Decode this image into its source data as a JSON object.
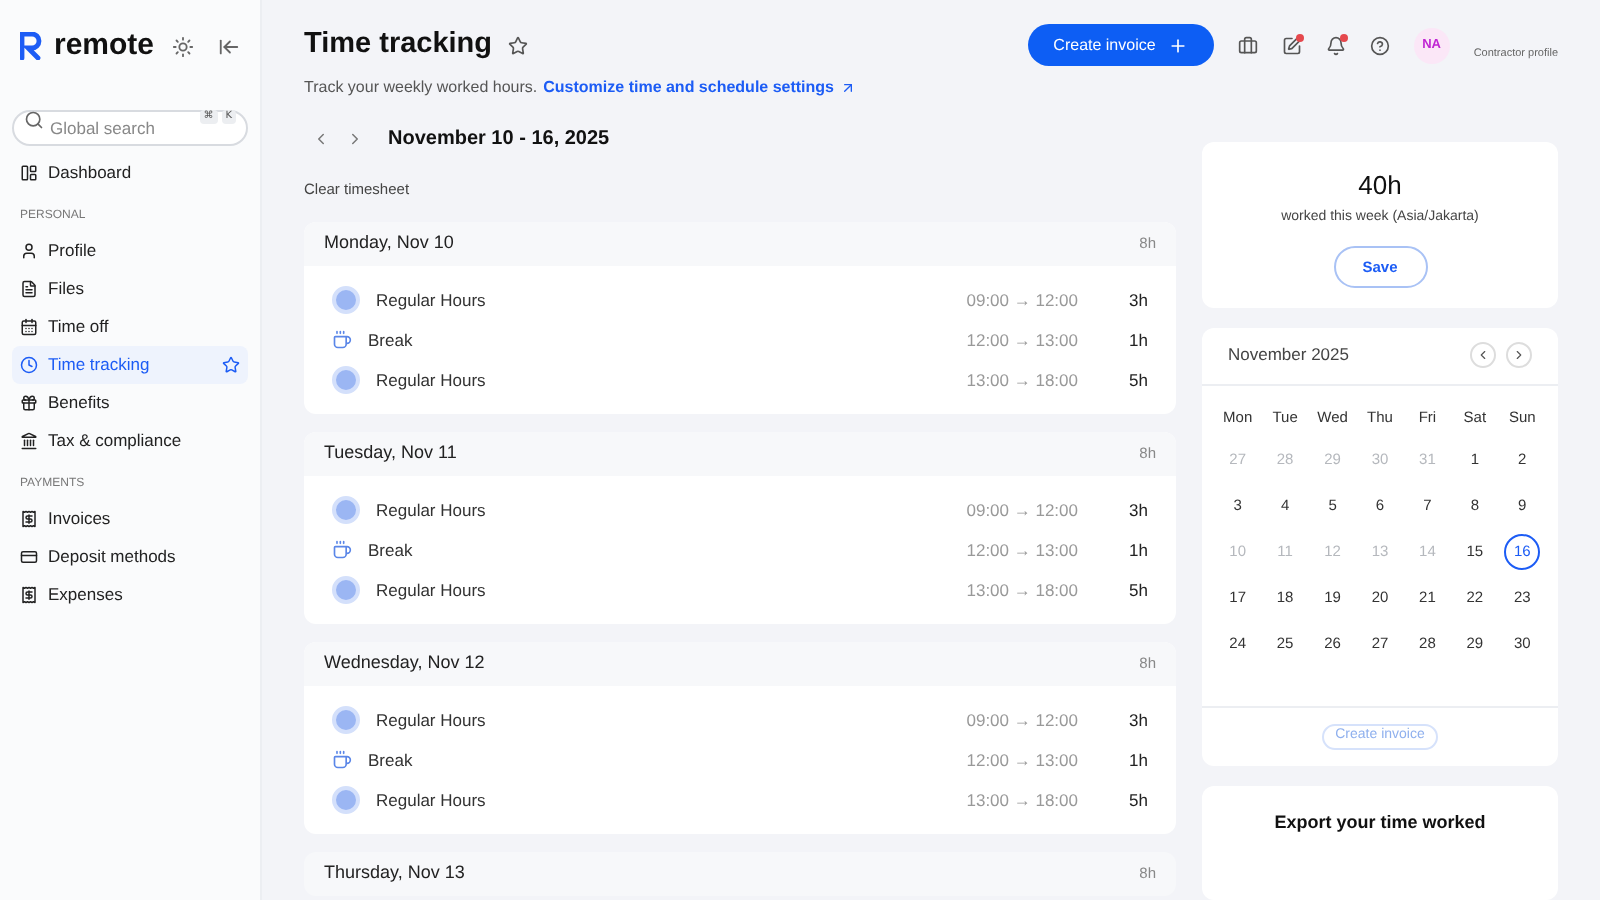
{
  "sidebar": {
    "brand": "remote",
    "search": {
      "placeholder": "Global search",
      "keys": [
        "⌘",
        "K"
      ]
    },
    "sections": [
      {
        "items": [
          {
            "label": "Dashboard",
            "selected": false
          }
        ]
      },
      {
        "title": "PERSONAL",
        "items": [
          {
            "label": "Profile",
            "selected": false
          },
          {
            "label": "Files",
            "selected": false
          },
          {
            "label": "Time off",
            "selected": false
          },
          {
            "label": "Time tracking",
            "selected": true
          },
          {
            "label": "Benefits",
            "selected": false
          },
          {
            "label": "Tax & compliance",
            "selected": false
          }
        ]
      },
      {
        "title": "PAYMENTS",
        "items": [
          {
            "label": "Invoices",
            "selected": false
          },
          {
            "label": "Deposit methods",
            "selected": false
          },
          {
            "label": "Expenses",
            "selected": false
          }
        ]
      }
    ]
  },
  "header": {
    "title": "Time tracking",
    "subtitle": "Track your weekly worked hours.",
    "link": "Customize time and schedule settings",
    "primary_button": "Create invoice",
    "toolbar": [
      {
        "notification": false
      },
      {
        "notification": true
      },
      {
        "notification": true
      },
      {
        "notification": false
      }
    ],
    "avatar": "NA",
    "profile_label": "Contractor profile"
  },
  "week": {
    "range": "November 10 - 16, 2025",
    "clear": "Clear timesheet"
  },
  "days": [
    {
      "title": "Monday, Nov 10",
      "total": "8h",
      "entries": [
        {
          "kind": "regular",
          "label": "Regular Hours",
          "time": "09:00 → 12:00",
          "hours": "3h"
        },
        {
          "kind": "break",
          "label": "Break",
          "time": "12:00 → 13:00",
          "hours": "1h"
        },
        {
          "kind": "regular",
          "label": "Regular Hours",
          "time": "13:00 → 18:00",
          "hours": "5h"
        }
      ]
    },
    {
      "title": "Tuesday, Nov 11",
      "total": "8h",
      "entries": [
        {
          "kind": "regular",
          "label": "Regular Hours",
          "time": "09:00 → 12:00",
          "hours": "3h"
        },
        {
          "kind": "break",
          "label": "Break",
          "time": "12:00 → 13:00",
          "hours": "1h"
        },
        {
          "kind": "regular",
          "label": "Regular Hours",
          "time": "13:00 → 18:00",
          "hours": "5h"
        }
      ]
    },
    {
      "title": "Wednesday, Nov 12",
      "total": "8h",
      "entries": [
        {
          "kind": "regular",
          "label": "Regular Hours",
          "time": "09:00 → 12:00",
          "hours": "3h"
        },
        {
          "kind": "break",
          "label": "Break",
          "time": "12:00 → 13:00",
          "hours": "1h"
        },
        {
          "kind": "regular",
          "label": "Regular Hours",
          "time": "13:00 → 18:00",
          "hours": "5h"
        }
      ]
    },
    {
      "title": "Thursday, Nov 13",
      "total": "8h"
    }
  ],
  "summary": {
    "total": "40h",
    "caption": "worked this week (Asia/Jakarta)",
    "button": "Save"
  },
  "calendar": {
    "month": "November 2025",
    "weekdays": [
      "Mon",
      "Tue",
      "Wed",
      "Thu",
      "Fri",
      "Sat",
      "Sun"
    ],
    "days": [
      {
        "label": "27",
        "muted": true,
        "selected": false
      },
      {
        "label": "28",
        "muted": true,
        "selected": false
      },
      {
        "label": "29",
        "muted": true,
        "selected": false
      },
      {
        "label": "30",
        "muted": true,
        "selected": false
      },
      {
        "label": "31",
        "muted": true,
        "selected": false
      },
      {
        "label": "1",
        "muted": false,
        "selected": false
      },
      {
        "label": "2",
        "muted": false,
        "selected": false
      },
      {
        "label": "3",
        "muted": false,
        "selected": false
      },
      {
        "label": "4",
        "muted": false,
        "selected": false
      },
      {
        "label": "5",
        "muted": false,
        "selected": false
      },
      {
        "label": "6",
        "muted": false,
        "selected": false
      },
      {
        "label": "7",
        "muted": false,
        "selected": false
      },
      {
        "label": "8",
        "muted": false,
        "selected": false
      },
      {
        "label": "9",
        "muted": false,
        "selected": false
      },
      {
        "label": "10",
        "muted": true,
        "selected": false
      },
      {
        "label": "11",
        "muted": true,
        "selected": false
      },
      {
        "label": "12",
        "muted": true,
        "selected": false
      },
      {
        "label": "13",
        "muted": true,
        "selected": false
      },
      {
        "label": "14",
        "muted": true,
        "selected": false
      },
      {
        "label": "15",
        "muted": false,
        "selected": false
      },
      {
        "label": "16",
        "muted": false,
        "selected": true
      },
      {
        "label": "17",
        "muted": false,
        "selected": false
      },
      {
        "label": "18",
        "muted": false,
        "selected": false
      },
      {
        "label": "19",
        "muted": false,
        "selected": false
      },
      {
        "label": "20",
        "muted": false,
        "selected": false
      },
      {
        "label": "21",
        "muted": false,
        "selected": false
      },
      {
        "label": "22",
        "muted": false,
        "selected": false
      },
      {
        "label": "23",
        "muted": false,
        "selected": false
      },
      {
        "label": "24",
        "muted": false,
        "selected": false
      },
      {
        "label": "25",
        "muted": false,
        "selected": false
      },
      {
        "label": "26",
        "muted": false,
        "selected": false
      },
      {
        "label": "27",
        "muted": false,
        "selected": false
      },
      {
        "label": "28",
        "muted": false,
        "selected": false
      },
      {
        "label": "29",
        "muted": false,
        "selected": false
      },
      {
        "label": "30",
        "muted": false,
        "selected": false
      }
    ],
    "button": "Create invoice"
  },
  "export": {
    "title": "Export your time worked"
  }
}
